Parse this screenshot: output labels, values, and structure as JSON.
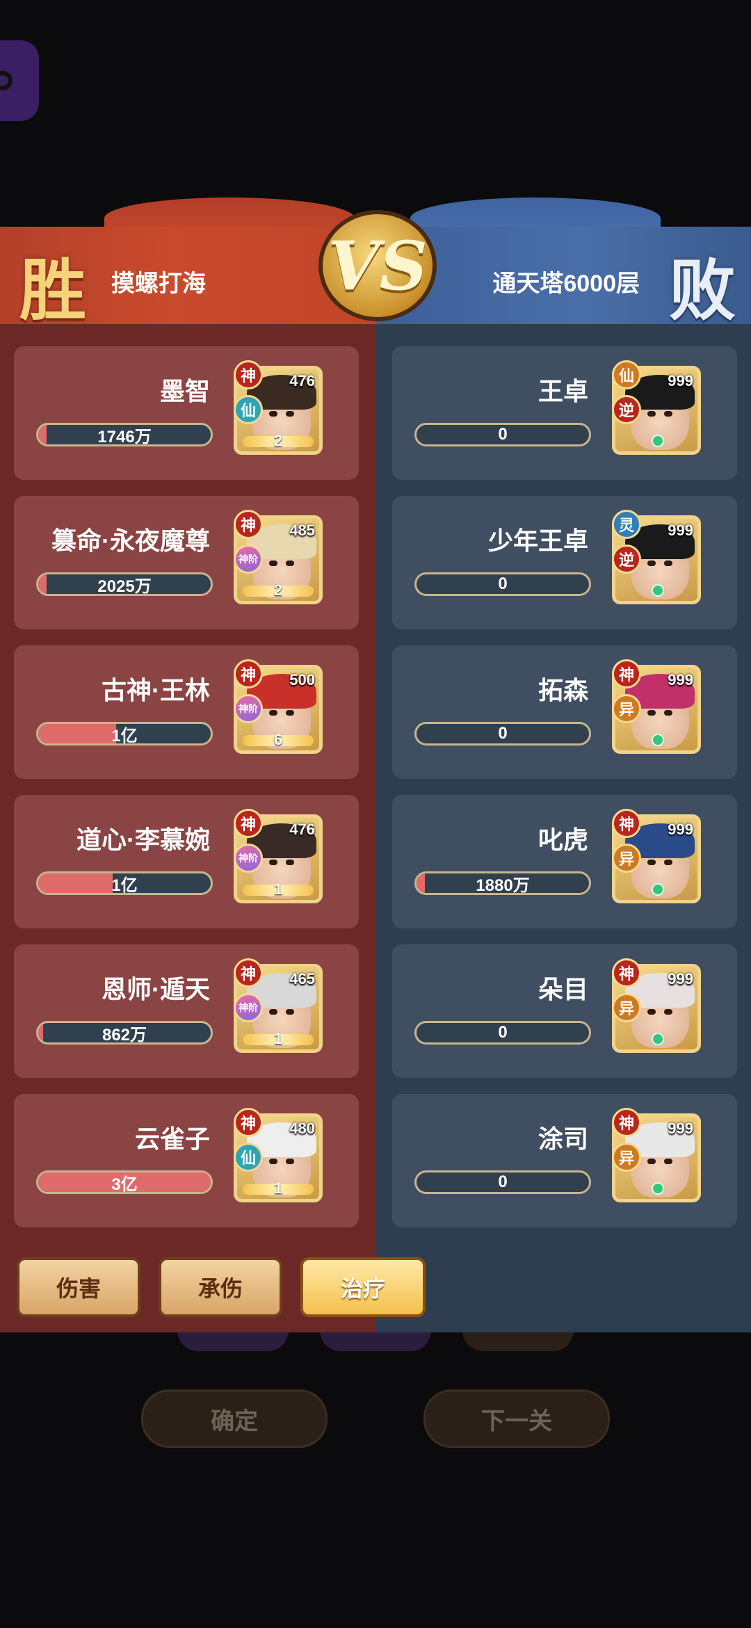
{
  "header": {
    "win_mark": "胜",
    "lose_mark": "败",
    "vs_text": "VS",
    "team_left": "摸螺打海",
    "team_right": "通天塔6000层"
  },
  "left_heroes": [
    {
      "name": "墨智",
      "value": "1746万",
      "fill": 0.05,
      "level": "476",
      "star": "2",
      "tag1": "神",
      "tag2": "仙",
      "tag2_style": "teal"
    },
    {
      "name": "篡命·永夜魔尊",
      "value": "2025万",
      "fill": 0.05,
      "level": "485",
      "star": "2",
      "tag1": "神",
      "tag2": "神阶",
      "tag2_style": "pink"
    },
    {
      "name": "古神·王林",
      "value": "1亿",
      "fill": 0.45,
      "level": "500",
      "star": "6",
      "tag1": "神",
      "tag2": "神阶",
      "tag2_style": "pink"
    },
    {
      "name": "道心·李慕婉",
      "value": "1亿",
      "fill": 0.43,
      "level": "476",
      "star": "1",
      "tag1": "神",
      "tag2": "神阶",
      "tag2_style": "pink"
    },
    {
      "name": "恩师·遁天",
      "value": "862万",
      "fill": 0.03,
      "level": "465",
      "star": "1",
      "tag1": "神",
      "tag2": "神阶",
      "tag2_style": "pink"
    },
    {
      "name": "云雀子",
      "value": "3亿",
      "fill": 1.0,
      "level": "480",
      "star": "1",
      "tag1": "神",
      "tag2": "仙",
      "tag2_style": "teal"
    }
  ],
  "right_heroes": [
    {
      "name": "王卓",
      "value": "0",
      "fill": 0,
      "level": "999",
      "tag1": "仙",
      "tag1_style": "orange",
      "tag2": "逆",
      "tag2_style": "red"
    },
    {
      "name": "少年王卓",
      "value": "0",
      "fill": 0,
      "level": "999",
      "tag1": "灵",
      "tag1_style": "blue",
      "tag2": "逆",
      "tag2_style": "red"
    },
    {
      "name": "拓森",
      "value": "0",
      "fill": 0,
      "level": "999",
      "tag1": "神",
      "tag1_style": "red",
      "tag2": "异",
      "tag2_style": "orange"
    },
    {
      "name": "叱虎",
      "value": "1880万",
      "fill": 0.05,
      "level": "999",
      "tag1": "神",
      "tag1_style": "red",
      "tag2": "异",
      "tag2_style": "orange"
    },
    {
      "name": "朵目",
      "value": "0",
      "fill": 0,
      "level": "999",
      "tag1": "神",
      "tag1_style": "red",
      "tag2": "异",
      "tag2_style": "orange"
    },
    {
      "name": "涂司",
      "value": "0",
      "fill": 0,
      "level": "999",
      "tag1": "神",
      "tag1_style": "red",
      "tag2": "异",
      "tag2_style": "orange"
    }
  ],
  "tabs": {
    "damage": "伤害",
    "taken": "承伤",
    "heal": "治疗"
  },
  "background_buttons": {
    "confirm": "确定",
    "next": "下一关"
  },
  "colors": {
    "win_panel": "#6b2826",
    "lose_panel": "#2e3d4f",
    "bar_fill": "#e06b6b",
    "gold": "#f1d38a"
  }
}
